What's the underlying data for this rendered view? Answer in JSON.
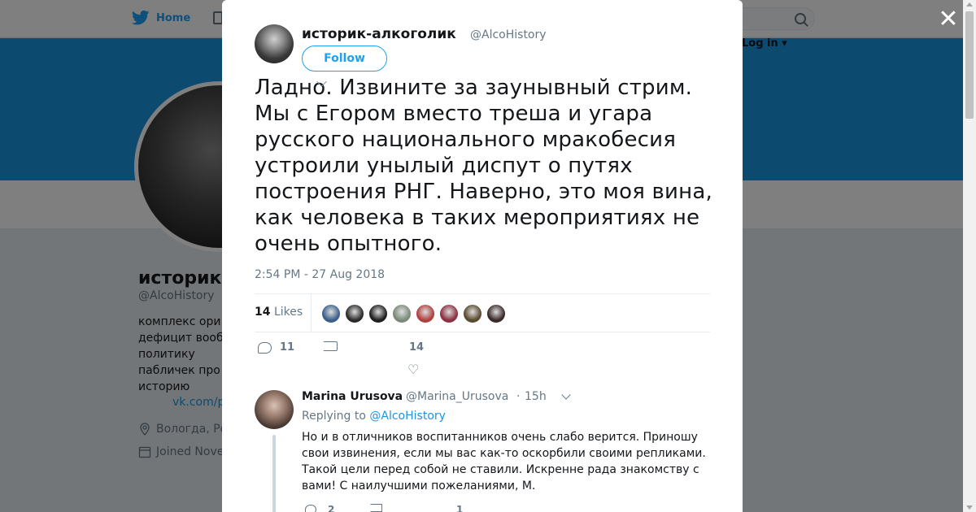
{
  "background": {
    "nav": {
      "home_label": "Home",
      "login_label": "Log in ▾"
    },
    "profile": {
      "name": "историк-",
      "handle": "@AlcoHistory",
      "bio_lines": [
        "комплекс ори",
        "дефицит вооб",
        "политику",
        "пабличек про",
        "историю"
      ],
      "link": "vk.com/p",
      "location": "Вологда, Ро",
      "joined": "Joined Nove"
    },
    "colors": {
      "banner": "#1b95e0",
      "accent": "#1da1f2"
    }
  },
  "modal": {
    "author": {
      "name": "историк-алкоголик",
      "handle": "@AlcoHistory",
      "follow_label": "Follow"
    },
    "tweet": {
      "text": "Ладно. Извините за заунывный стрим. Мы с Егором вместо треша и угара русского национального мракобесия устроили унылый диспут о путях построения РНГ. Наверно, это моя вина, как человека в таких мероприятиях не очень опытного.",
      "timestamp": "2:54 PM - 27 Aug 2018"
    },
    "stats": {
      "likes_count": "14",
      "likes_label": "Likes"
    },
    "likers": [
      {
        "color": "#3a5f8a"
      },
      {
        "color": "#2b2b2b"
      },
      {
        "color": "#1e1e1e"
      },
      {
        "color": "#7a8a7a"
      },
      {
        "color": "#b04040"
      },
      {
        "color": "#8a3040"
      },
      {
        "color": "#5a4a30"
      },
      {
        "color": "#3a2a2a"
      }
    ],
    "actions": {
      "reply_count": "11",
      "retweet_count": "",
      "like_count": "14"
    },
    "reply": {
      "name": "Marina Urusova",
      "handle": "@Marina_Urusova",
      "separator": "·",
      "time": "15h",
      "replying_prefix": "Replying to",
      "replying_to": "@AlcoHistory",
      "text": "Но и в отличников воспитанников очень слабо верится. Приношу свои извинения, если мы вас как-то оскорбили своими репликами. Такой цели перед собой не ставили. Искренне рада знакомству с вами! С наилучшими пожеланиями, М.",
      "reply_count": "2",
      "like_count": "1"
    }
  }
}
